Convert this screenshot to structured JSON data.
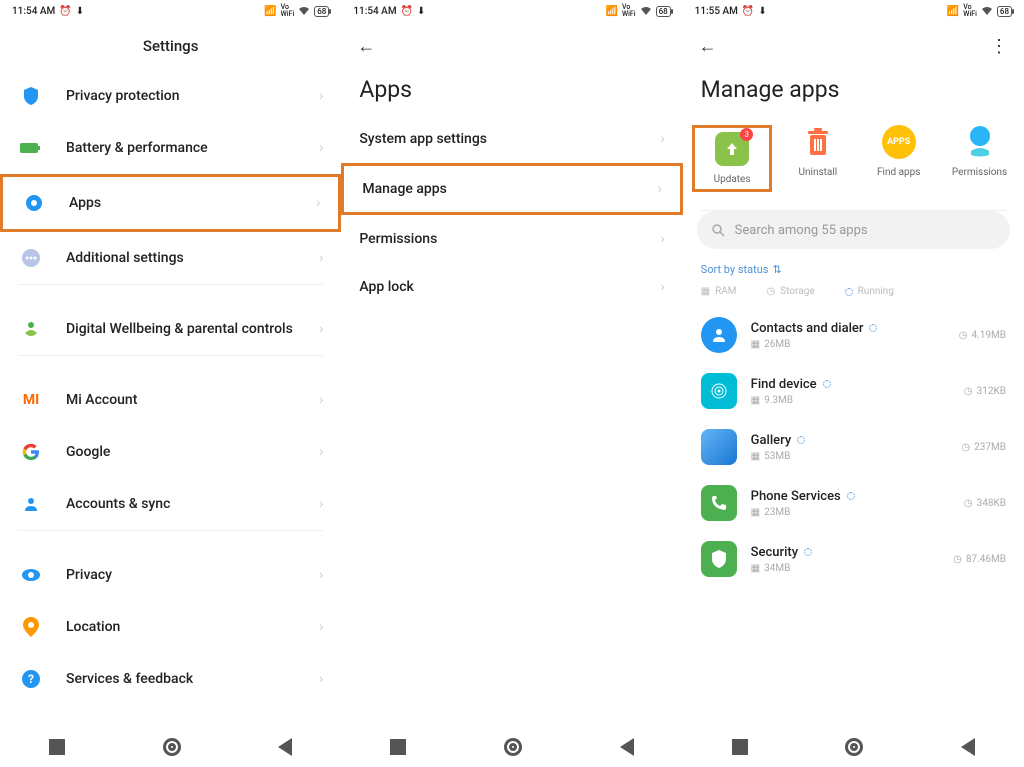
{
  "status": {
    "time1": "11:54 AM",
    "time2": "11:54 AM",
    "time3": "11:55 AM",
    "battery": "68"
  },
  "screen1": {
    "title": "Settings",
    "items": [
      {
        "label": "Privacy protection"
      },
      {
        "label": "Battery & performance"
      },
      {
        "label": "Apps"
      },
      {
        "label": "Additional settings"
      },
      {
        "label": "Digital Wellbeing & parental controls"
      },
      {
        "label": "Mi Account"
      },
      {
        "label": "Google"
      },
      {
        "label": "Accounts & sync"
      },
      {
        "label": "Privacy"
      },
      {
        "label": "Location"
      },
      {
        "label": "Services & feedback"
      }
    ]
  },
  "screen2": {
    "title": "Apps",
    "items": [
      {
        "label": "System app settings"
      },
      {
        "label": "Manage apps"
      },
      {
        "label": "Permissions"
      },
      {
        "label": "App lock"
      }
    ]
  },
  "screen3": {
    "title": "Manage apps",
    "actions": [
      {
        "label": "Updates",
        "badge": "3"
      },
      {
        "label": "Uninstall"
      },
      {
        "label": "Find apps"
      },
      {
        "label": "Permissions"
      }
    ],
    "search_placeholder": "Search among 55 apps",
    "sort_label": "Sort by status",
    "filters": {
      "ram": "RAM",
      "storage": "Storage",
      "running": "Running"
    },
    "apps": [
      {
        "name": "Contacts and dialer",
        "mem": "26MB",
        "storage": "4.19MB"
      },
      {
        "name": "Find device",
        "mem": "9.3MB",
        "storage": "312KB"
      },
      {
        "name": "Gallery",
        "mem": "53MB",
        "storage": "237MB"
      },
      {
        "name": "Phone Services",
        "mem": "23MB",
        "storage": "348KB"
      },
      {
        "name": "Security",
        "mem": "34MB",
        "storage": "87.46MB"
      }
    ]
  }
}
